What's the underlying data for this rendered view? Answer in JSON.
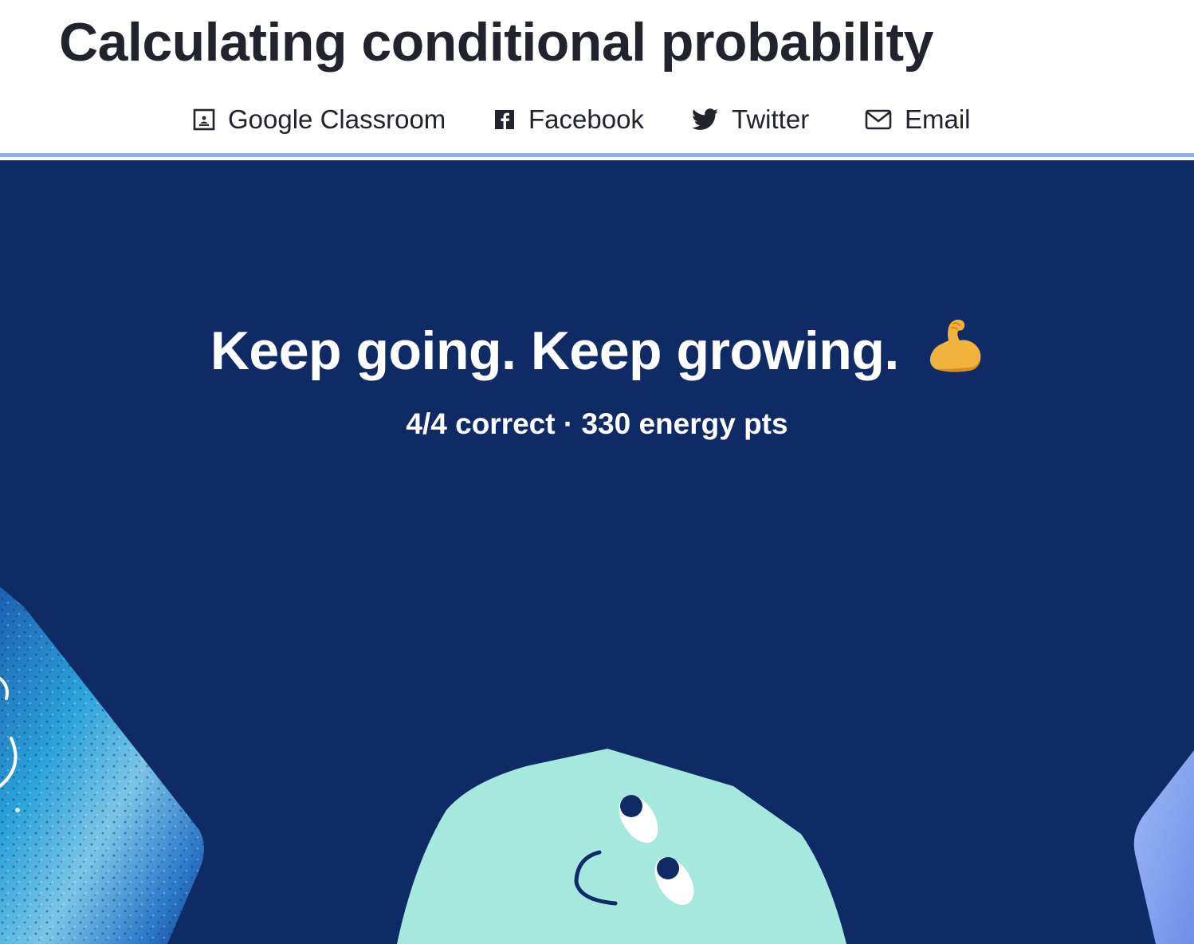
{
  "page": {
    "title": "Calculating conditional probability"
  },
  "share": {
    "items": [
      {
        "label": "Google Classroom",
        "icon": "google-classroom-icon"
      },
      {
        "label": "Facebook",
        "icon": "facebook-icon"
      },
      {
        "label": "Twitter",
        "icon": "twitter-icon"
      },
      {
        "label": "Email",
        "icon": "email-icon"
      }
    ]
  },
  "result": {
    "headline": "Keep going. Keep growing.",
    "emoji": "flexed-biceps",
    "stats": "4/4 correct · 330 energy pts",
    "correct": 4,
    "total": 4,
    "energy_points": 330
  },
  "colors": {
    "title_text": "#21242c",
    "hero_background": "#0f2b65",
    "divider": "#8fb0ec",
    "character_mint": "#a6e8dd",
    "character_light_blue": "#8fa8ee"
  }
}
